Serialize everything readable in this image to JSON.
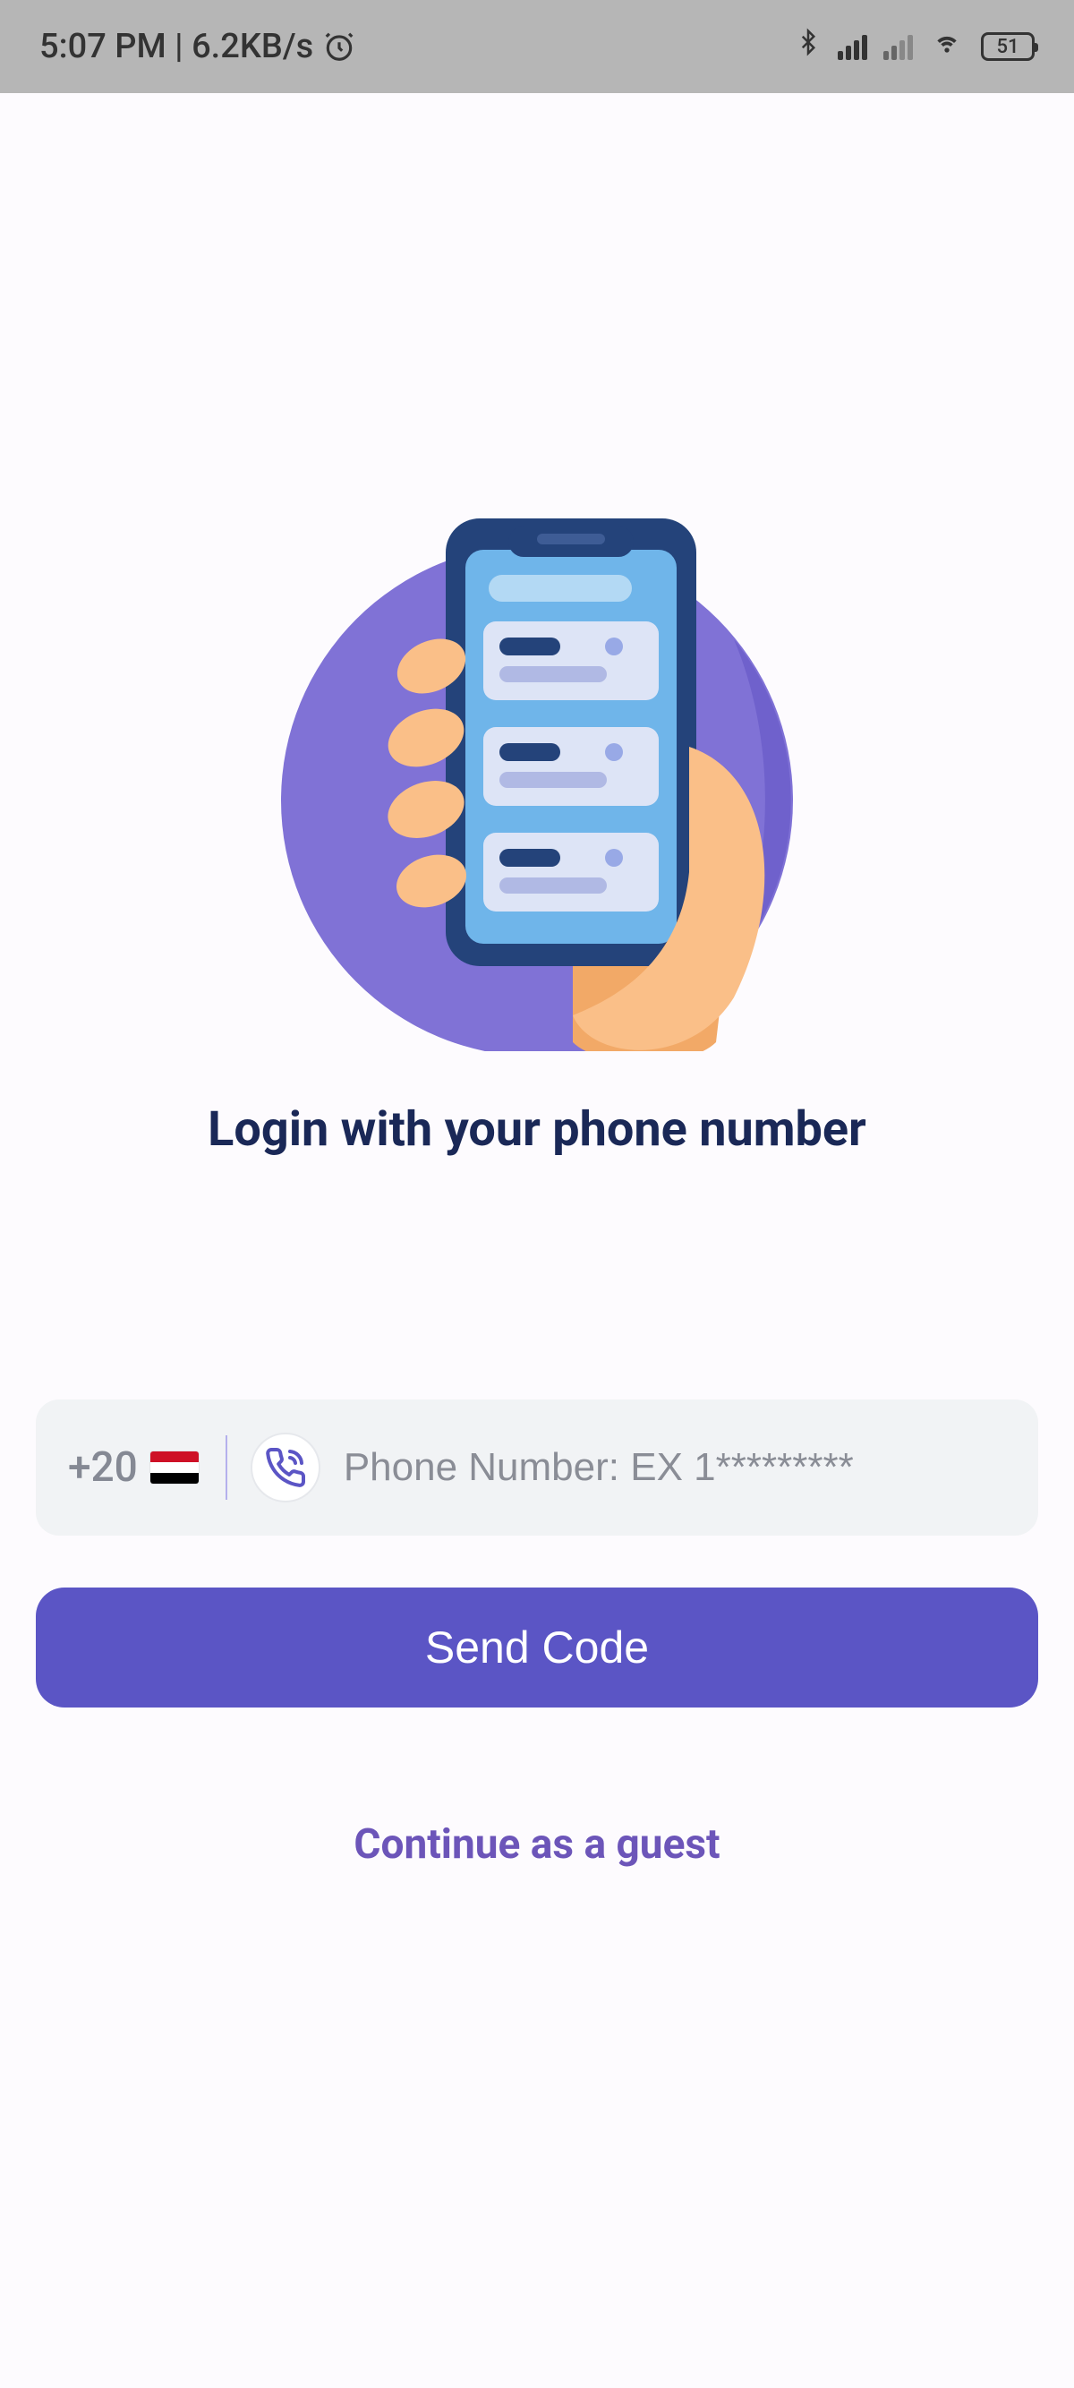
{
  "statusbar": {
    "time_text": "5:07 PM | 6.2KB/s",
    "battery": "51"
  },
  "login": {
    "title": "Login with your phone number",
    "country_code": "+20",
    "phone_placeholder": "Phone Number: EX 1*********",
    "send_label": "Send Code",
    "guest_label": "Continue as a guest"
  }
}
